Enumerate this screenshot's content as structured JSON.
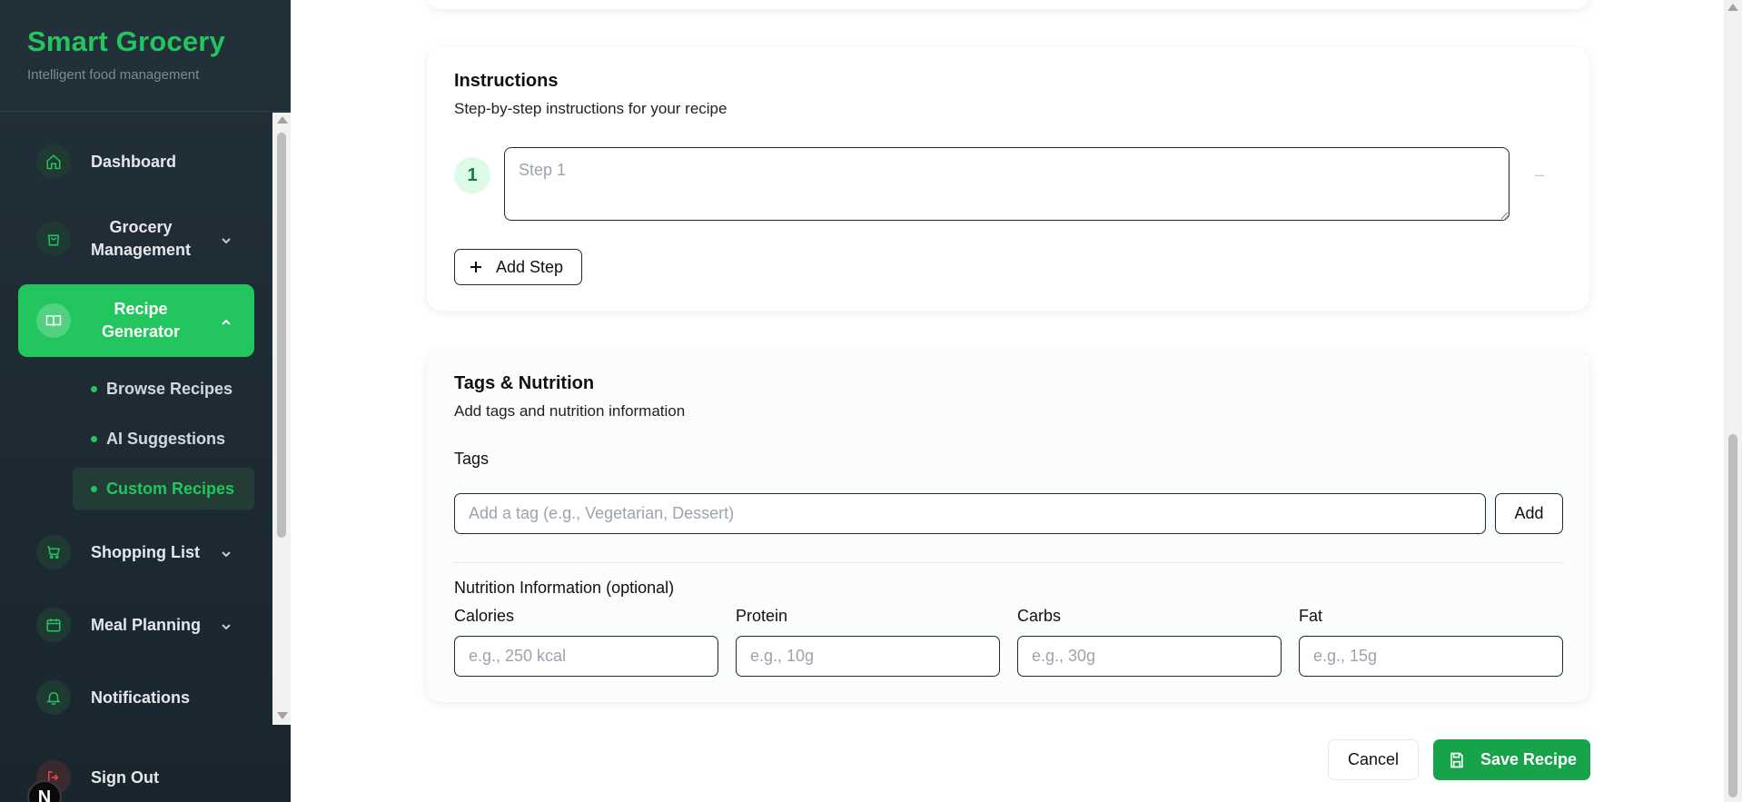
{
  "brand": {
    "title": "Smart Grocery",
    "subtitle": "Intelligent food management"
  },
  "sidebar": {
    "items": [
      {
        "label": "Dashboard",
        "icon": "home-icon"
      },
      {
        "label": "Grocery Management",
        "icon": "shopping-bag-icon"
      },
      {
        "label": "Recipe Generator",
        "icon": "book-open-icon"
      },
      {
        "label": "Shopping List",
        "icon": "cart-icon"
      },
      {
        "label": "Meal Planning",
        "icon": "calendar-icon"
      },
      {
        "label": "Notifications",
        "icon": "bell-icon"
      }
    ],
    "subitems": [
      {
        "label": "Browse Recipes"
      },
      {
        "label": "AI Suggestions"
      },
      {
        "label": "Custom Recipes"
      }
    ],
    "signout": "Sign Out",
    "badge": "N"
  },
  "instructions": {
    "title": "Instructions",
    "subtitle": "Step-by-step instructions for your recipe",
    "step_number": "1",
    "step_placeholder": "Step 1",
    "remove_label": "–",
    "add_step_label": "Add Step"
  },
  "tags_nutrition": {
    "title": "Tags & Nutrition",
    "subtitle": "Add tags and nutrition information",
    "tags_label": "Tags",
    "tag_placeholder": "Add a tag (e.g., Vegetarian, Dessert)",
    "add_label": "Add",
    "nutrition_title": "Nutrition Information (optional)",
    "fields": [
      {
        "label": "Calories",
        "placeholder": "e.g., 250 kcal"
      },
      {
        "label": "Protein",
        "placeholder": "e.g., 10g"
      },
      {
        "label": "Carbs",
        "placeholder": "e.g., 30g"
      },
      {
        "label": "Fat",
        "placeholder": "e.g., 15g"
      }
    ]
  },
  "actions": {
    "cancel": "Cancel",
    "save": "Save Recipe"
  },
  "colors": {
    "accent": "#22c55e",
    "sidebar_bg": "#1f2c35",
    "save_bg": "#16a34a"
  }
}
